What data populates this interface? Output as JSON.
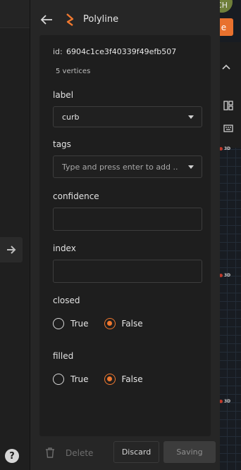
{
  "header": {
    "title": "Polyline",
    "back_icon": "arrow-left-icon",
    "shape_icon": "polyline-icon",
    "accent": "#f0782f"
  },
  "meta": {
    "id_label": "id:",
    "id_value": "6904c1ce3f40339f49efb507",
    "vertices": "5 vertices"
  },
  "fields": {
    "label": {
      "name": "label",
      "value": "curb"
    },
    "tags": {
      "name": "tags",
      "placeholder": "Type and press enter to add ..."
    },
    "confidence": {
      "name": "confidence",
      "value": ""
    },
    "index": {
      "name": "index",
      "value": ""
    },
    "closed": {
      "name": "closed",
      "true_label": "True",
      "false_label": "False",
      "selected": "False"
    },
    "filled": {
      "name": "filled",
      "true_label": "True",
      "false_label": "False",
      "selected": "False"
    }
  },
  "footer": {
    "delete_label": "Delete",
    "discard_label": "Discard",
    "saving_label": "Saving"
  },
  "background": {
    "avatar_text": "CH",
    "orange_button_text": "e",
    "badge_3d": "3D",
    "help": "?"
  }
}
